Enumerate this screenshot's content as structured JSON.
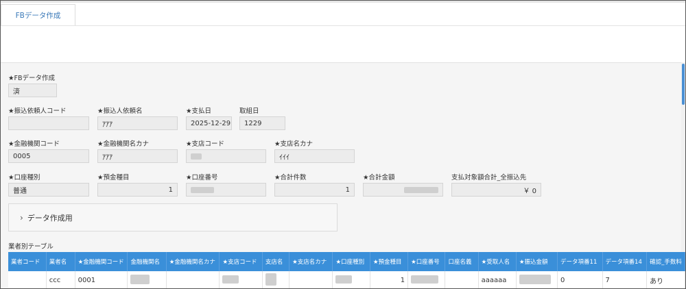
{
  "tab": {
    "label": "FBデータ作成"
  },
  "form": {
    "fb_created": {
      "label": "★FBデータ作成",
      "value": "済"
    },
    "requester_code": {
      "label": "★振込依頼人コード",
      "value": ""
    },
    "requester_name": {
      "label": "★振込人依頼名",
      "value": "ｱｱｱ"
    },
    "pay_date": {
      "label": "★支払日",
      "value": "2025-12-29"
    },
    "group_date": {
      "label": "取組日",
      "value": "1229"
    },
    "bank_code": {
      "label": "★金融機関コード",
      "value": "0005"
    },
    "bank_kana": {
      "label": "★金融機関名カナ",
      "value": "ｱｱｱ"
    },
    "branch_code": {
      "label": "★支店コード",
      "value": ""
    },
    "branch_kana": {
      "label": "★支店名カナ",
      "value": "ｲｲｲ"
    },
    "account_type": {
      "label": "★口座種別",
      "value": "普通"
    },
    "deposit_item": {
      "label": "★預金種目",
      "value": "1"
    },
    "account_number": {
      "label": "★口座番号",
      "value": ""
    },
    "total_count": {
      "label": "★合計件数",
      "value": "1"
    },
    "total_amount": {
      "label": "★合計金額",
      "value": ""
    },
    "payment_total": {
      "label": "支払対象額合計_全振込先",
      "value": "￥ 0"
    }
  },
  "section": {
    "label": "データ作成用",
    "chevron": "chevron-right-icon"
  },
  "table": {
    "title": "業者別テーブル",
    "headers": [
      "業者コード",
      "業者名",
      "★金融機関コード",
      "金融機関名",
      "★金融機関名カナ",
      "★支店コード",
      "支店名",
      "★支店名カナ",
      "★口座種別",
      "★預金種目",
      "★口座番号",
      "口座名義",
      "★受取人名",
      "★振込金額",
      "データ項番11",
      "データ項番14",
      "確認_手数料"
    ],
    "rows": [
      [
        "",
        "ccc",
        "0001",
        "",
        "",
        "",
        "",
        "",
        "",
        "1",
        "",
        "",
        "aaaaaa",
        "",
        "0",
        "7",
        "あり"
      ]
    ]
  },
  "colors": {
    "header_bg": "#3a8fd9",
    "tab_text": "#3a79b8",
    "form_bg": "#f5f5f5"
  }
}
